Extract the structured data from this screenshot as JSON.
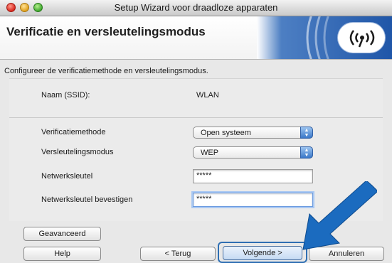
{
  "window": {
    "title": "Setup Wizard voor draadloze apparaten"
  },
  "header": {
    "title": "Verificatie en versleutelingsmodus"
  },
  "instruction": "Configureer de verificatiemethode en versleutelingsmodus.",
  "ssid": {
    "label": "Naam (SSID):",
    "value": "WLAN"
  },
  "auth": {
    "label": "Verificatiemethode",
    "selected": "Open systeem"
  },
  "encryption": {
    "label": "Versleutelingsmodus",
    "selected": "WEP"
  },
  "network_key": {
    "label": "Netwerksleutel",
    "value": "*****"
  },
  "confirm_key": {
    "label": "Netwerksleutel bevestigen",
    "value": "*****"
  },
  "buttons": {
    "advanced": "Geavanceerd",
    "help": "Help",
    "back": "< Terug",
    "next": "Volgende >",
    "cancel": "Annuleren"
  },
  "colors": {
    "brand_blue": "#1f56a8",
    "pointer_arrow": "#1b6bbf",
    "default_button": "#c6dbf3"
  },
  "icons": {
    "window_controls": [
      "close-icon",
      "minimize-icon",
      "zoom-icon"
    ],
    "brand": "wifi-signal-icon",
    "popup": "up-down-arrows-icon",
    "annotation": "pointer-arrow-icon"
  }
}
